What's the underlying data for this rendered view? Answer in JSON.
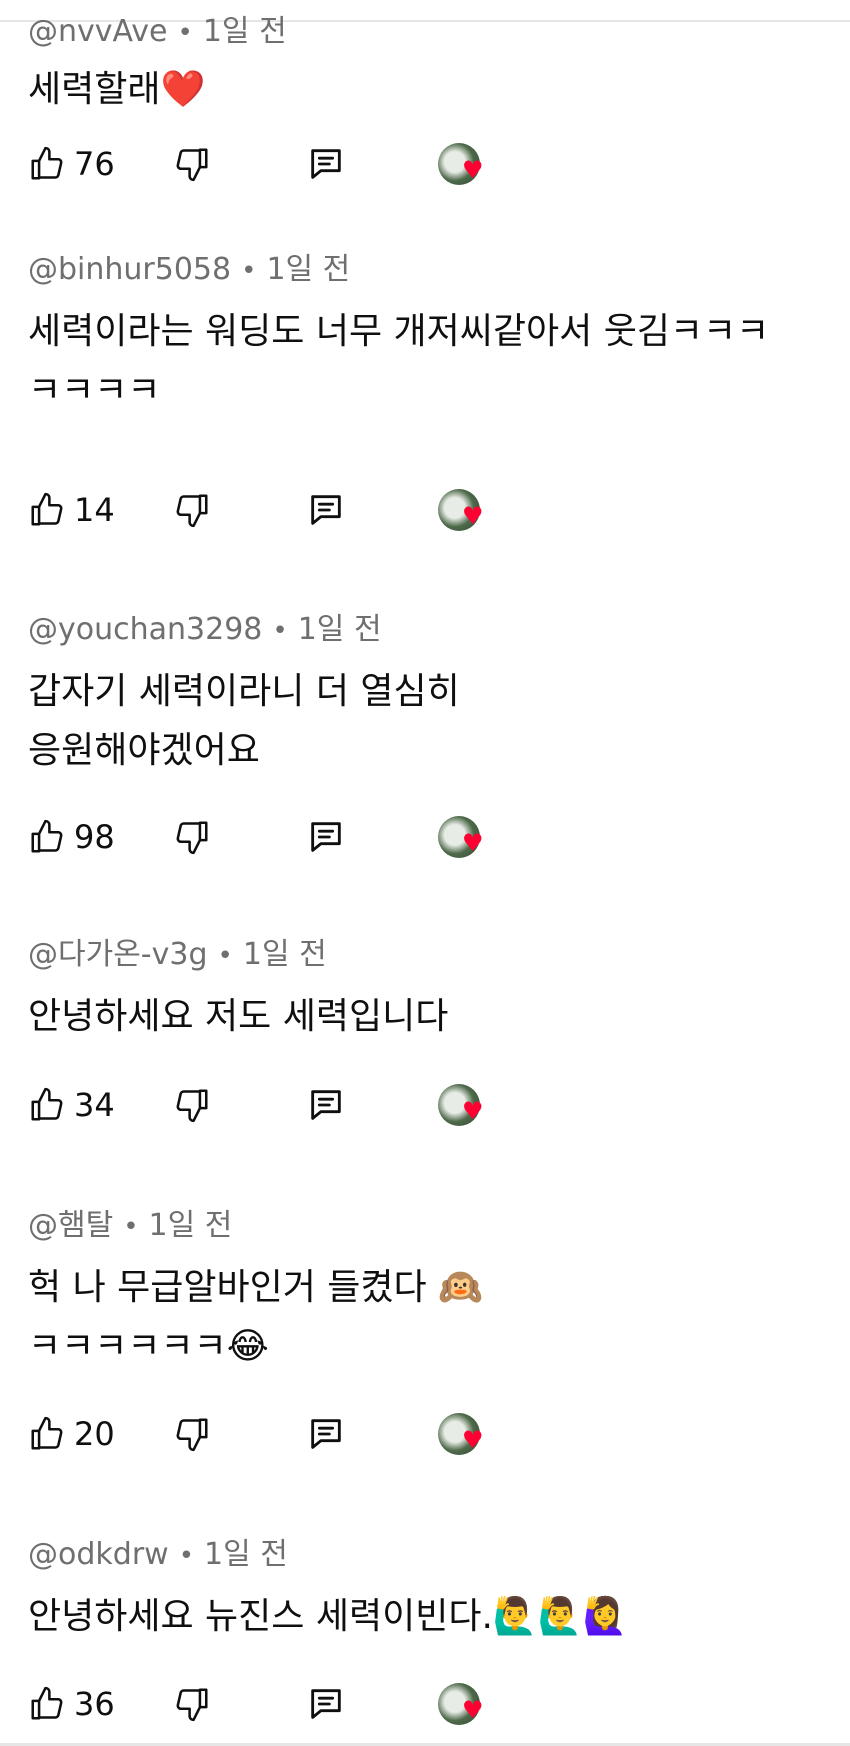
{
  "comments": [
    {
      "handle": "@nvvAve",
      "time": "1일 전",
      "text": "세력할래",
      "emoji": "❤️",
      "likes": "76"
    },
    {
      "handle": "@binhur5058",
      "time": "1일 전",
      "text": "세력이라는 워딩도 너무 개저씨같아서 웃김ㅋㅋㅋ\nㅋㅋㅋㅋ",
      "emoji": "",
      "likes": "14"
    },
    {
      "handle": "@youchan3298",
      "time": "1일 전",
      "text": "갑자기 세력이라니 더 열심히\n응원해야겠어요",
      "emoji": "",
      "likes": "98"
    },
    {
      "handle": "@다가온-v3g",
      "time": "1일 전",
      "text": "안녕하세요 저도 세력입니다",
      "emoji": "",
      "likes": "34"
    },
    {
      "handle": "@햄탈",
      "time": "1일 전",
      "text": "헉 나 무급알바인거 들켰다 🙉\nㅋㅋㅋㅋㅋㅋ",
      "emoji": "😂",
      "likes": "20"
    },
    {
      "handle": "@odkdrw",
      "time": "1일 전",
      "text": "안녕하세요 뉴진스 세력이빈다.",
      "emoji": "🙋‍♂️🙋‍♂️🙋‍♀️",
      "likes": "36"
    }
  ],
  "icons": {
    "like": "thumbs-up-icon",
    "dislike": "thumbs-down-icon",
    "reply": "comment-icon",
    "creator_heart": "heart-icon"
  },
  "colors": {
    "meta": "#6f6f6f",
    "heart": "#ff0033"
  }
}
